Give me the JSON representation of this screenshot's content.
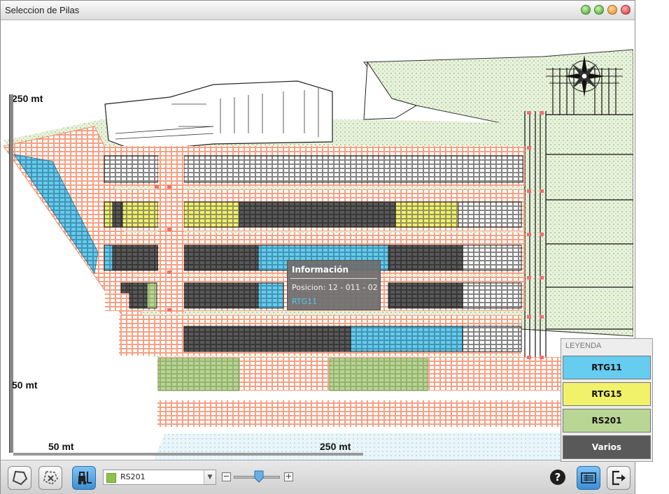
{
  "window": {
    "title": "Seleccion de Pilas"
  },
  "colors": {
    "rtg11": "#66ccf0",
    "rtg15": "#f2f26a",
    "rs201": "#b9d694",
    "varios": "#595959",
    "empty_cell": "#f59a7d",
    "grass": "#cfe3c0",
    "water": "#cde7f2"
  },
  "scales": {
    "top_left": "250 mt",
    "bottom_left": "50 mt",
    "bottom_a": "50 mt",
    "bottom_b": "250 mt"
  },
  "tooltip": {
    "title": "Información",
    "position": "Posicion: 12 - 011 - 02",
    "equipment": "RTG11"
  },
  "legend": {
    "title": "LEYENDA",
    "items": [
      {
        "label": "RTG11",
        "color": "#66ccf0"
      },
      {
        "label": "RTG15",
        "color": "#f2f26a"
      },
      {
        "label": "RS201",
        "color": "#b9d694"
      },
      {
        "label": "Varios",
        "color": "#595959"
      }
    ]
  },
  "toolbar": {
    "equipment_select": {
      "value": "RS201",
      "swatch": "#8bc34a"
    },
    "zoom_level_fraction": 0.55,
    "help_label": "?"
  },
  "icons": {
    "polygon": "polygon-icon",
    "clear_selection": "clear-selection-icon",
    "forklift": "forklift-icon",
    "list": "list-view-icon",
    "exit": "exit-icon",
    "compass": "compass-rose-icon"
  }
}
